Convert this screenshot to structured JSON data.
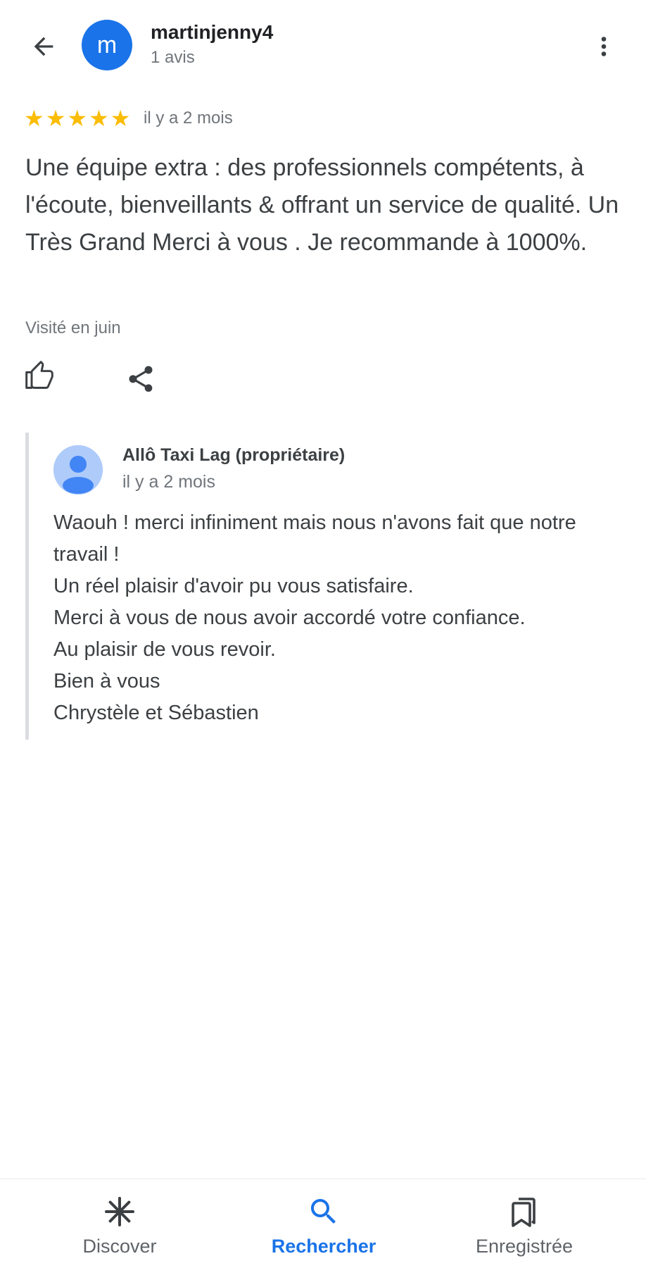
{
  "header": {
    "avatar_letter": "m",
    "user_name": "martinjenny4",
    "user_reviews": "1 avis"
  },
  "review": {
    "rating": 5,
    "time": "il y a 2 mois",
    "text": "Une équipe extra : des professionnels compétents, à l'écoute, bienveillants & offrant un service de qualité. Un Très Grand Merci à vous . Je recommande à 1000%.",
    "visited": "Visité en juin"
  },
  "owner_reply": {
    "name": "Allô Taxi Lag (propriétaire)",
    "time": "il y a 2 mois",
    "lines": [
      "Waouh ! merci infiniment mais nous n'avons fait que notre travail !",
      "Un réel plaisir d'avoir pu vous satisfaire.",
      "Merci à vous de nous avoir accordé votre confiance.",
      "Au plaisir de vous revoir.",
      "Bien à vous",
      "Chrystèle et Sébastien"
    ]
  },
  "bottom_nav": {
    "items": [
      {
        "label": "Discover",
        "icon": "asterisk-icon"
      },
      {
        "label": "Rechercher",
        "icon": "search-icon",
        "active": true
      },
      {
        "label": "Enregistrée",
        "icon": "bookmarks-icon"
      }
    ]
  },
  "colors": {
    "accent": "#1a73e8",
    "star": "#fbbc04",
    "text": "#3c4043",
    "secondary": "#70757a"
  }
}
